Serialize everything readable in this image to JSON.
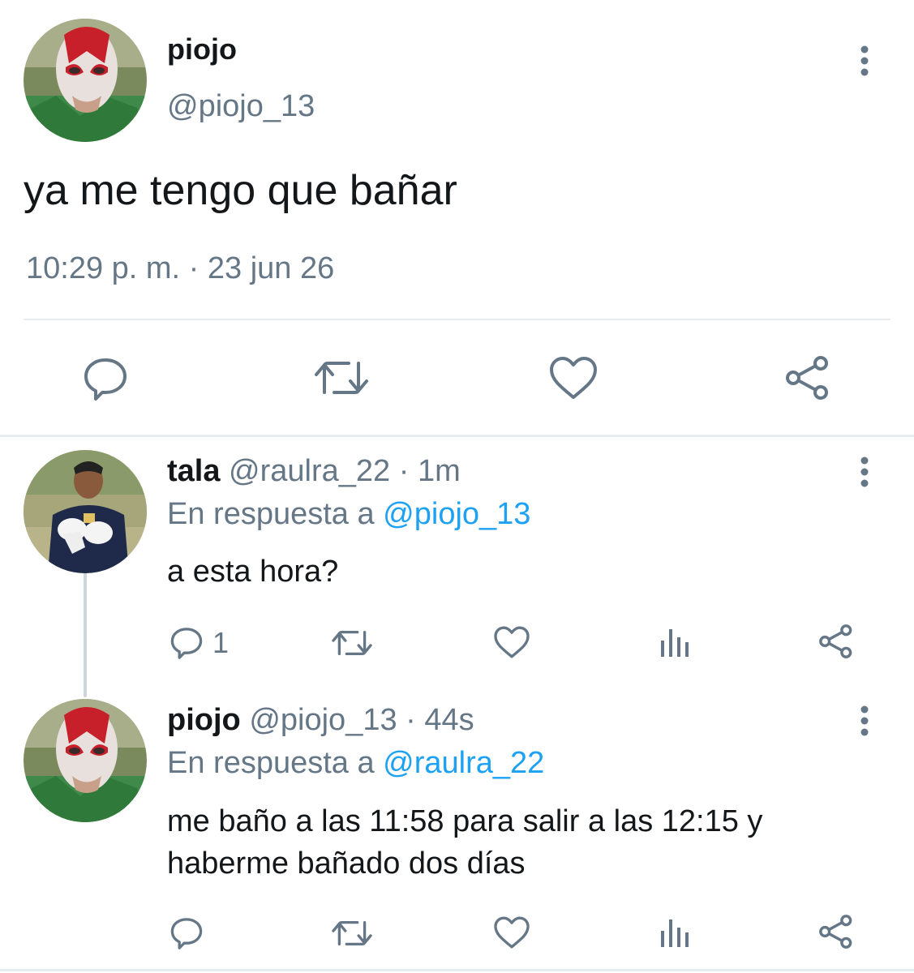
{
  "main_tweet": {
    "display_name": "piojo",
    "handle": "@piojo_13",
    "text": "ya me tengo que bañar",
    "timestamp": "10:29 p. m. · 23 jun 26",
    "avatar_icon": "luchador-mask-avatar"
  },
  "replies": [
    {
      "display_name": "tala",
      "handle_time": "@raulra_22 · 1m",
      "reply_prefix": "En respuesta a ",
      "reply_to": "@piojo_13",
      "text": "a esta hora?",
      "reply_count": "1",
      "avatar_icon": "goalkeeper-avatar"
    },
    {
      "display_name": "piojo",
      "handle_time": "@piojo_13 · 44s",
      "reply_prefix": "En respuesta a ",
      "reply_to": "@raulra_22",
      "text_line1": "me baño a las 11:58 para salir a las 12:15 y",
      "text_line2": "haberme bañado dos días",
      "reply_count": "",
      "avatar_icon": "luchador-mask-avatar"
    }
  ],
  "colors": {
    "text": "#14171a",
    "muted": "#657786",
    "link": "#1da1f2",
    "divider": "#e6ecf0"
  }
}
